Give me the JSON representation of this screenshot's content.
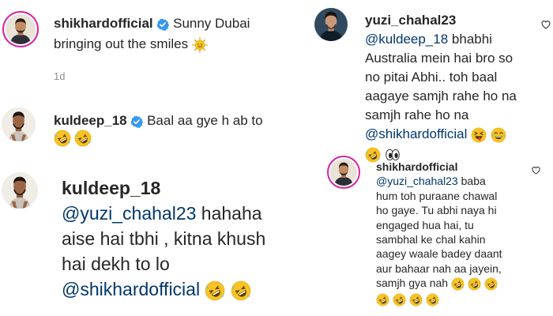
{
  "post": {
    "username": "shikhardofficial",
    "caption_line1": "Sunny Dubai",
    "caption_line2": "bringing out the smiles",
    "time": "1d"
  },
  "comment1": {
    "username": "kuldeep_18",
    "text_line1": "Baal aa gye h ab to"
  },
  "comment2": {
    "username": "kuldeep_18",
    "mention1": "@yuzi_chahal23",
    "text_line1": "hahaha",
    "text_line2": "aise hai tbhi , kitna khush",
    "text_line3": "hai dekh to lo",
    "mention2": "@shikhardofficial"
  },
  "right_comment1": {
    "username": "yuzi_chahal23",
    "mention1": "@kuldeep_18",
    "text_line1": "bhabhi",
    "text_line2": "Australia mein hai bro so",
    "text_line3": "no pitai Abhi.. toh baal",
    "text_line4": "aagaye samjh rahe ho na",
    "text_line5": "samjh rahe ho na",
    "mention2": "@shikhardofficial"
  },
  "right_comment2": {
    "username": "shikhardofficial",
    "mention1": "@yuzi_chahal23",
    "text_line1": "baba",
    "text_line2": "hum toh puraane chawal",
    "text_line3": "ho gaye. Tu abhi naya hi",
    "text_line4": "engaged hua hai, tu",
    "text_line5": "sambhal ke chal kahin",
    "text_line6": "aagey waale badey daant",
    "text_line7": "aur bahaar nah aa jayein,",
    "text_line8": "samjh gya nah"
  },
  "colors": {
    "verified": "#3897f0",
    "mention": "#00376b",
    "story_ring": "#d6249f",
    "emoji_yellow": "#f7c325"
  },
  "icons": {
    "verified": "verified-badge-icon",
    "heart": "heart-outline-icon",
    "sun": "sun-emoji",
    "rofl": "rofl-emoji",
    "squint": "squinting-tongue-emoji",
    "joy": "joy-emoji",
    "eyes": "eyes-emoji"
  }
}
